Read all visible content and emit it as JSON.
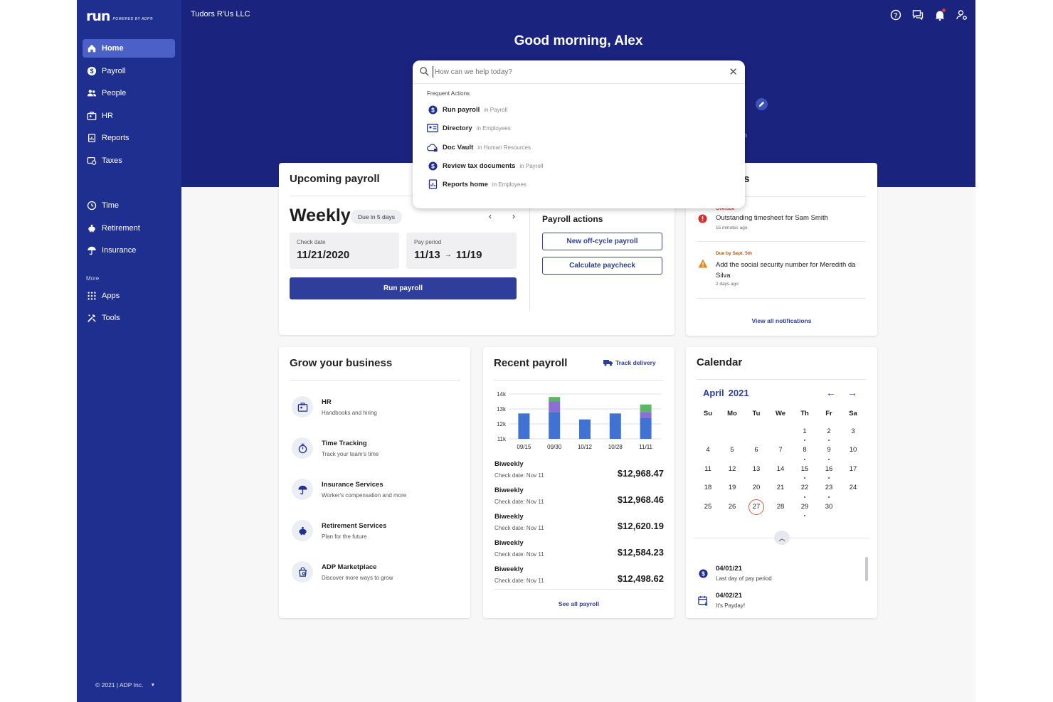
{
  "brand": {
    "logo": "run",
    "logo_sub": "POWERED BY ADP®"
  },
  "sidebar": {
    "items": [
      {
        "label": "Home"
      },
      {
        "label": "Payroll"
      },
      {
        "label": "People"
      },
      {
        "label": "HR"
      },
      {
        "label": "Reports"
      },
      {
        "label": "Taxes"
      },
      {
        "label": "Time"
      },
      {
        "label": "Retirement"
      },
      {
        "label": "Insurance"
      },
      {
        "label": "Apps"
      },
      {
        "label": "Tools"
      }
    ],
    "more_label": "More",
    "copyright": "© 2021 | ADP Inc."
  },
  "header": {
    "company": "Tudors R'Us LLC",
    "greeting": "Good morning, Alex",
    "stray_text": "m"
  },
  "search": {
    "placeholder": "How can we help today?",
    "section_label": "Frequent Actions",
    "actions": [
      {
        "title": "Run payroll",
        "context": "in Payroll"
      },
      {
        "title": "Directory",
        "context": "in Employees"
      },
      {
        "title": "Doc Vault",
        "context": "in Human Resources"
      },
      {
        "title": "Review tax documents",
        "context": "in Payroll"
      },
      {
        "title": "Reports home",
        "context": "in Employees"
      }
    ]
  },
  "upcoming_payroll": {
    "title": "Upcoming payroll",
    "frequency": "Weekly",
    "due_badge": "Due in 5 days",
    "check_date_label": "Check date",
    "check_date": "11/21/2020",
    "pay_period_label": "Pay period",
    "pay_period_start": "11/13",
    "pay_period_end": "11/19",
    "run_button": "Run payroll",
    "actions_title": "Payroll actions",
    "off_cycle_button": "New off-cycle payroll",
    "calc_button": "Calculate paycheck"
  },
  "todos": {
    "title_partial": "os",
    "items": [
      {
        "status": "Overdue",
        "status_color": "#d32f2f",
        "text": "Outstanding timesheet for Sam Smith",
        "time": "15 minutes ago"
      },
      {
        "status": "Due by Sept. 5th",
        "status_color": "#b25b00",
        "text": "Add the social security number for Meredith da Silva",
        "time": "2 days ago"
      }
    ],
    "view_all": "View all notifications"
  },
  "grow": {
    "title": "Grow your business",
    "items": [
      {
        "title": "HR",
        "desc": "Handbooks and hiring",
        "icon": "hr-icon"
      },
      {
        "title": "Time Tracking",
        "desc": "Track your team's time",
        "icon": "stopwatch-icon"
      },
      {
        "title": "Insurance Services",
        "desc": "Worker's compensation and more",
        "icon": "umbrella-icon"
      },
      {
        "title": "Retirement Services",
        "desc": "Plan for the future",
        "icon": "piggy-bank-icon"
      },
      {
        "title": "ADP Marketplace",
        "desc": "Discover more ways to grow",
        "icon": "marketplace-icon"
      }
    ]
  },
  "recent_payroll": {
    "title": "Recent payroll",
    "track_delivery": "Track delivery",
    "rows": [
      {
        "freq": "Biweekly",
        "check": "Check date: Nov 11",
        "amount": "$12,968.47"
      },
      {
        "freq": "Biweekly",
        "check": "Check date: Nov 11",
        "amount": "$12,968.46"
      },
      {
        "freq": "Biweekly",
        "check": "Check date: Nov 11",
        "amount": "$12,620.19"
      },
      {
        "freq": "Biweekly",
        "check": "Check date: Nov 11",
        "amount": "$12,584.23"
      },
      {
        "freq": "Biweekly",
        "check": "Check date: Nov 11",
        "amount": "$12,498.62"
      }
    ],
    "see_all": "See all payroll"
  },
  "chart_data": {
    "type": "bar",
    "categories": [
      "09/15",
      "09/30",
      "10/12",
      "10/28",
      "11/11"
    ],
    "series": [
      {
        "values": [
          12.7,
          12.8,
          12.3,
          12.7,
          12.4
        ],
        "color": "#3f72d2"
      },
      {
        "values": [
          0,
          0.7,
          0,
          0,
          0.4
        ],
        "color": "#8c6fd4"
      },
      {
        "values": [
          0,
          0.3,
          0,
          0,
          0.5
        ],
        "color": "#59b864"
      }
    ],
    "yticks": [
      "14k",
      "13k",
      "12k",
      "11k"
    ],
    "ylim": [
      11,
      14
    ],
    "stacked": true,
    "grid": true
  },
  "calendar": {
    "title": "Calendar",
    "month": "April",
    "year": "2021",
    "weekdays": [
      "Su",
      "Mo",
      "Tu",
      "We",
      "Th",
      "Fr",
      "Sa"
    ],
    "weeks": [
      [
        "",
        "",
        "",
        "",
        "1",
        "2",
        "3"
      ],
      [
        "4",
        "5",
        "6",
        "7",
        "8",
        "9",
        "10"
      ],
      [
        "11",
        "12",
        "13",
        "14",
        "15",
        "16",
        "17"
      ],
      [
        "18",
        "19",
        "20",
        "21",
        "22",
        "23",
        "24"
      ],
      [
        "25",
        "26",
        "27",
        "28",
        "29",
        "30",
        ""
      ]
    ],
    "event_days": [
      "1",
      "2",
      "8",
      "9",
      "15",
      "16",
      "22",
      "23",
      "29"
    ],
    "today": "27",
    "events": [
      {
        "date": "04/01/21",
        "desc": "Last day of pay period",
        "icon": "dollar-icon"
      },
      {
        "date": "04/02/21",
        "desc": "It's Payday!",
        "icon": "calendar-dollar-icon"
      }
    ]
  },
  "colors": {
    "sidebar": "#1f2f8f",
    "header": "#1a237e",
    "accent": "#2e3e9a",
    "today_ring": "#e05a3d"
  }
}
